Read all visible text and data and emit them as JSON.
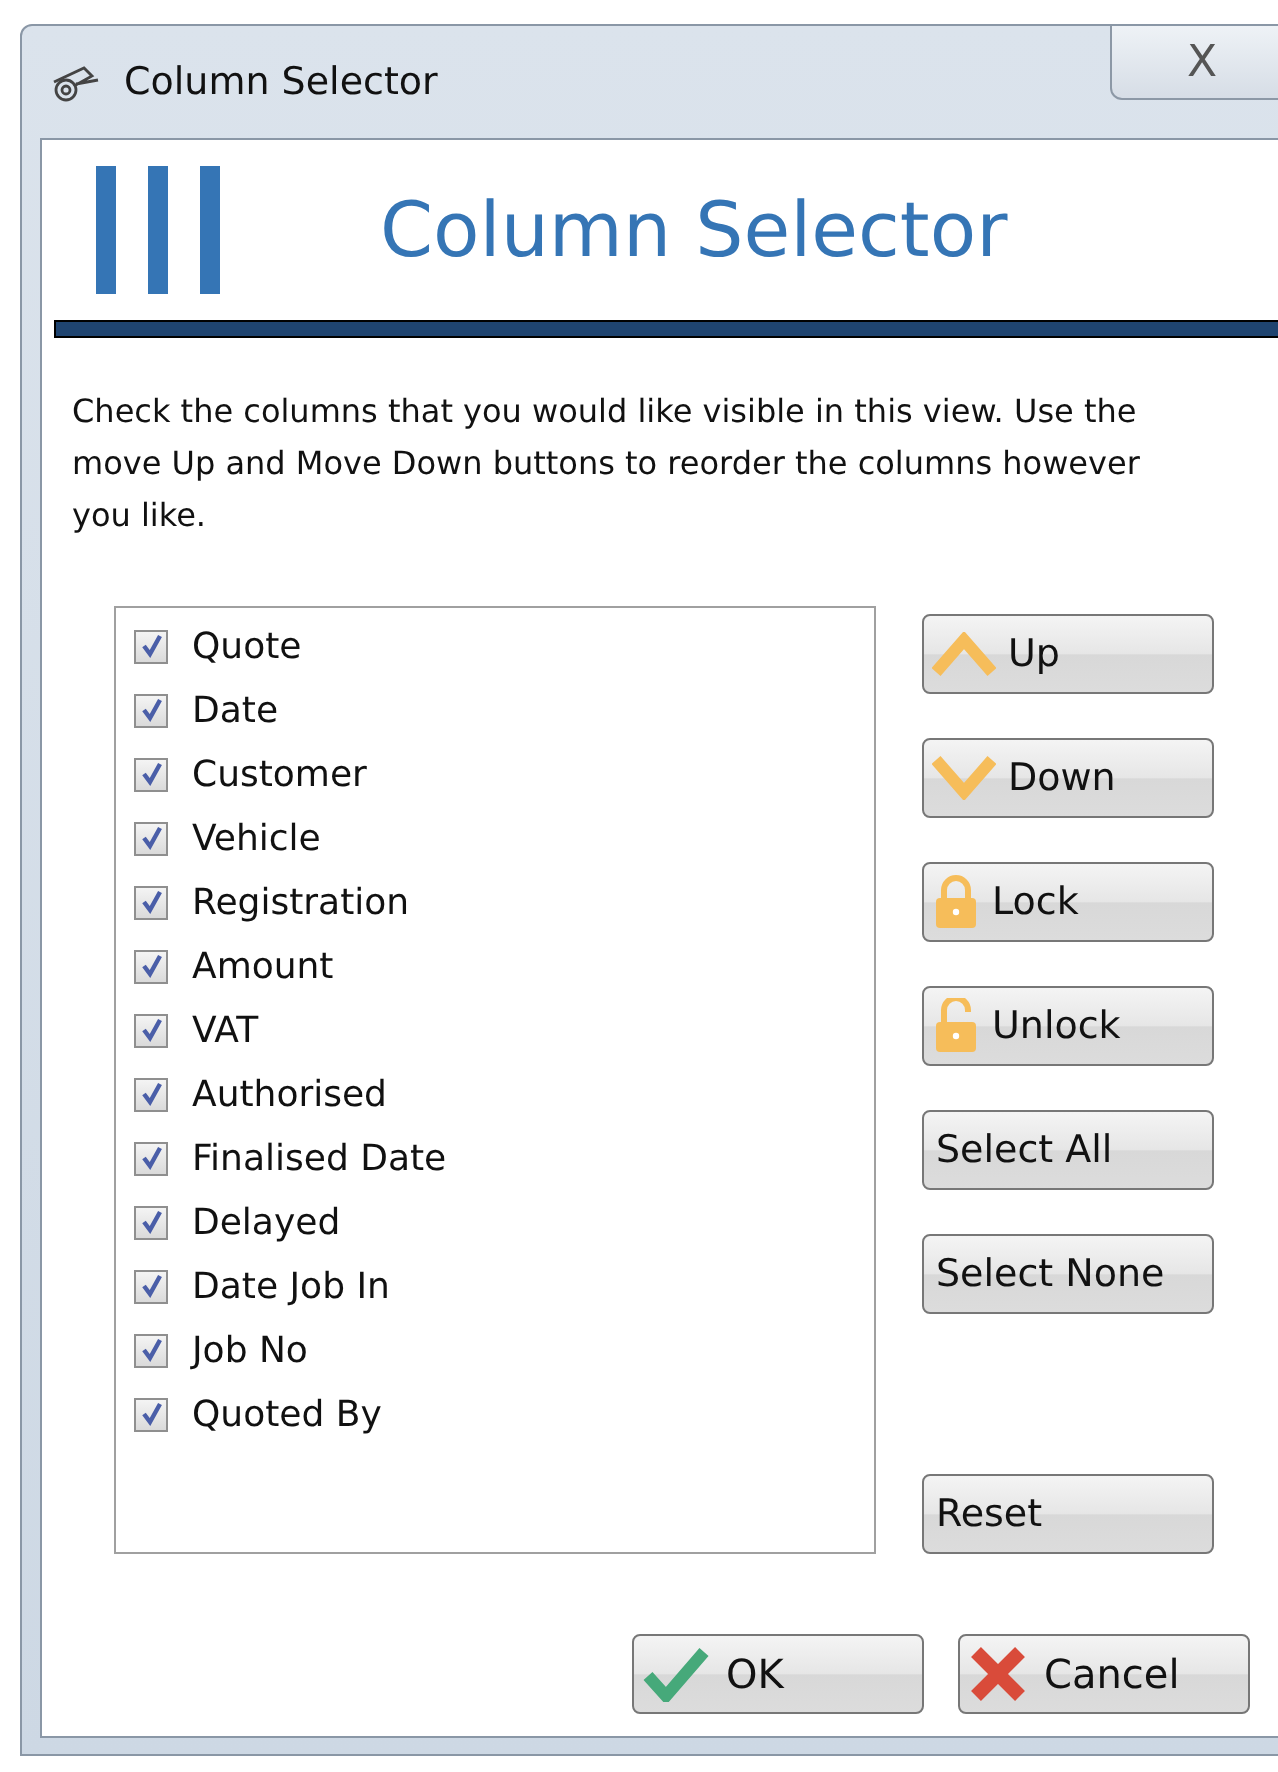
{
  "window": {
    "title": "Column Selector",
    "close_label": "X"
  },
  "header": {
    "title": "Column Selector"
  },
  "instructions": "Check the columns that you would like visible in this view. Use the move Up and Move Down buttons to reorder the columns however you like.",
  "columns": [
    {
      "label": "Quote",
      "checked": true
    },
    {
      "label": "Date",
      "checked": true
    },
    {
      "label": "Customer",
      "checked": true
    },
    {
      "label": "Vehicle",
      "checked": true
    },
    {
      "label": "Registration",
      "checked": true
    },
    {
      "label": "Amount",
      "checked": true
    },
    {
      "label": "VAT",
      "checked": true
    },
    {
      "label": "Authorised",
      "checked": true
    },
    {
      "label": "Finalised Date",
      "checked": true
    },
    {
      "label": "Delayed",
      "checked": true
    },
    {
      "label": "Date Job In",
      "checked": true
    },
    {
      "label": "Job No",
      "checked": true
    },
    {
      "label": "Quoted By",
      "checked": true
    }
  ],
  "side_buttons": [
    {
      "label": "Up",
      "kind": "up"
    },
    {
      "label": "Down",
      "kind": "down"
    },
    {
      "label": "Lock",
      "kind": "lock"
    },
    {
      "label": "Unlock",
      "kind": "unlock"
    },
    {
      "label": "Select All",
      "kind": "plain"
    },
    {
      "label": "Select None",
      "kind": "plain"
    }
  ],
  "reset_button": "Reset",
  "footer_buttons": [
    {
      "label": "OK",
      "kind": "ok"
    },
    {
      "label": "Cancel",
      "kind": "cancel"
    }
  ]
}
